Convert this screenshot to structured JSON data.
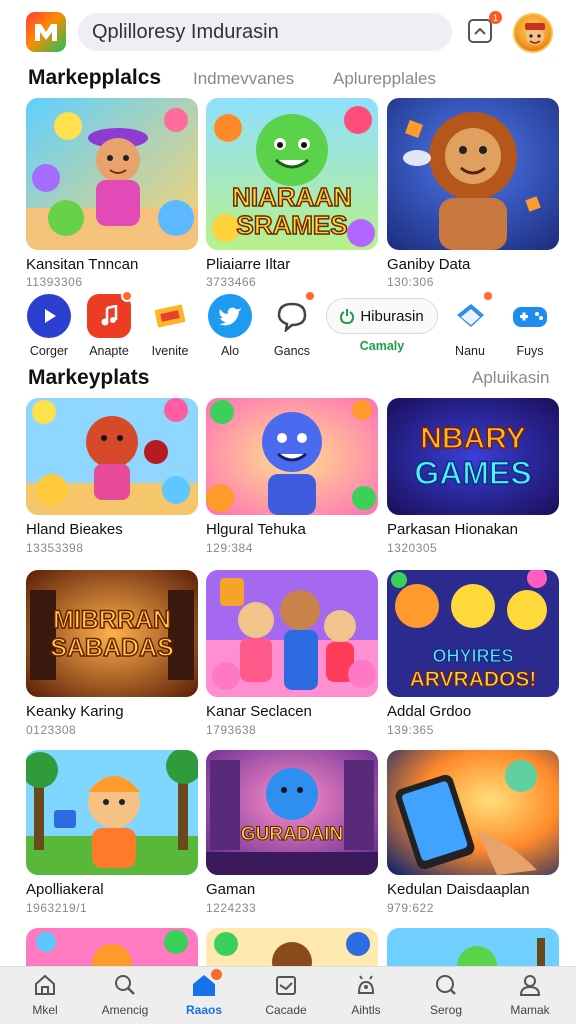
{
  "header": {
    "search_text": "Qplilloresy Imdurasin",
    "notification_count": "1"
  },
  "section1": {
    "title": "Markepplalcs",
    "tabs": [
      "Indmevvanes",
      "Aplurepplales"
    ],
    "cards": [
      {
        "name": "Kansitan Tnncan",
        "meta": "11393306"
      },
      {
        "name": "Pliaiarre Iltar",
        "meta": "3733466"
      },
      {
        "name": "Ganiby Data",
        "meta": "130:306"
      }
    ]
  },
  "shortcuts": [
    {
      "label": "Corger",
      "icon": "play-icon"
    },
    {
      "label": "Anapte",
      "icon": "music-icon"
    },
    {
      "label": "Ivenite",
      "icon": "ticket-icon"
    },
    {
      "label": "Alo",
      "icon": "twitter-bird-icon"
    },
    {
      "label": "Gancs",
      "icon": "chat-icon"
    },
    {
      "label": "Nanu",
      "icon": "tag-icon"
    },
    {
      "label": "Fuys",
      "icon": "gamepad-icon"
    }
  ],
  "pill": {
    "text": "Hiburasin",
    "label": "Camaly"
  },
  "section2": {
    "title": "Markeyplats",
    "link": "Apluikasin",
    "cards": [
      {
        "name": "Hland Bieakes",
        "meta": "13353398"
      },
      {
        "name": "Hlgural Tehuka",
        "meta": "129:384"
      },
      {
        "name": "Parkasan Hionakan",
        "meta": "1320305"
      },
      {
        "name": "Keanky Karing",
        "meta": "0123308"
      },
      {
        "name": "Kanar Seclacen",
        "meta": "1793638"
      },
      {
        "name": "Addal Grdoo",
        "meta": "139:365"
      },
      {
        "name": "Apolliakeral",
        "meta": "1963219/1"
      },
      {
        "name": "Gaman",
        "meta": "1224233"
      },
      {
        "name": "Kedulan Daisdaaplan",
        "meta": "979:622"
      }
    ]
  },
  "thumb_text": {
    "t2": [
      "NIARAAN",
      "SRAMES"
    ],
    "t6": [
      "NBARY",
      "GAMES"
    ],
    "t7": [
      "MIBRRAN",
      "SABADAS"
    ],
    "t9": [
      "OHYIRES",
      "ARVRADOS!"
    ],
    "t11": [
      "GURADAIN"
    ]
  },
  "bottom_nav": [
    {
      "label": "Mkel",
      "icon": "home-icon"
    },
    {
      "label": "Amencig",
      "icon": "search-icon"
    },
    {
      "label": "Raaos",
      "icon": "home-filled-icon",
      "active": true
    },
    {
      "label": "Cacade",
      "icon": "calendar-icon"
    },
    {
      "label": "Aihtls",
      "icon": "android-icon"
    },
    {
      "label": "Serog",
      "icon": "search-icon"
    },
    {
      "label": "Mamak",
      "icon": "profile-icon"
    }
  ]
}
